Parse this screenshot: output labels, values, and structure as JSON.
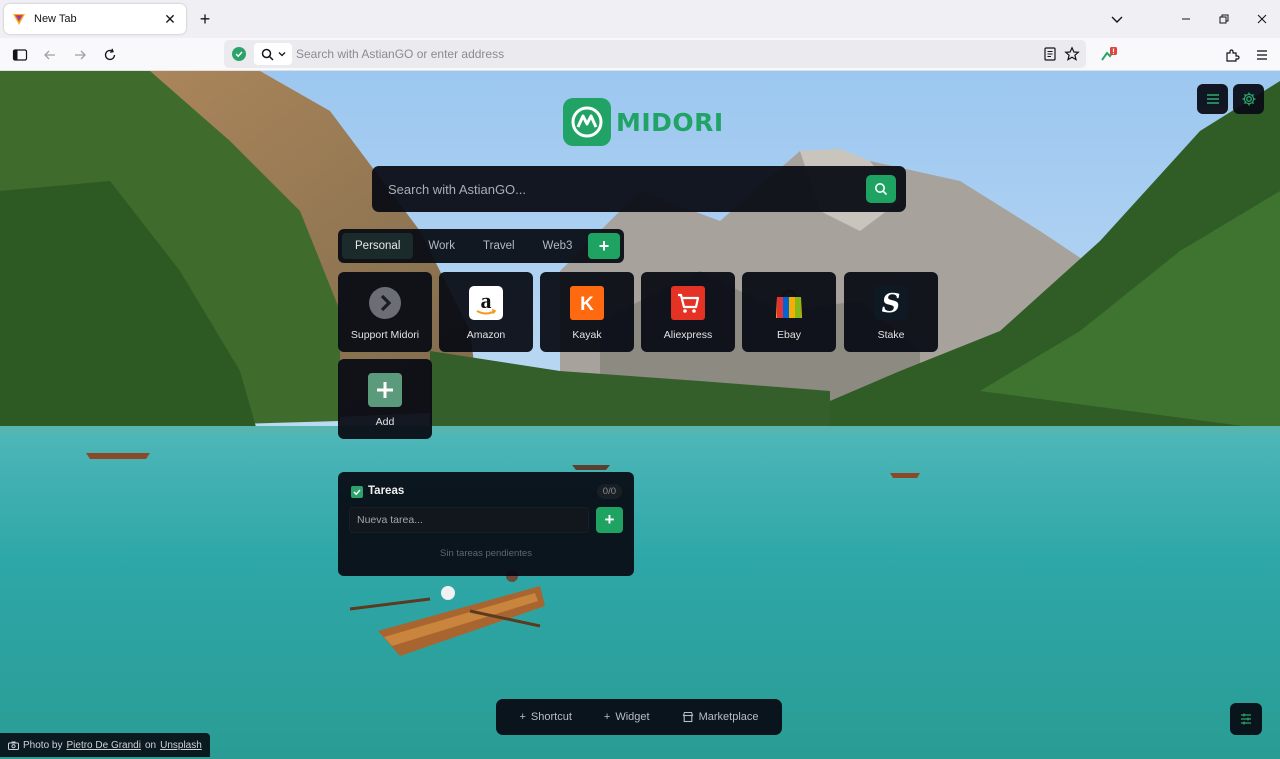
{
  "browser": {
    "tab_title": "New Tab",
    "address_placeholder": "Search with AstianGO or enter address"
  },
  "logo": {
    "text": "MIDORI"
  },
  "search": {
    "placeholder": "Search with AstianGO..."
  },
  "groups": [
    {
      "label": "Personal",
      "active": true
    },
    {
      "label": "Work"
    },
    {
      "label": "Travel"
    },
    {
      "label": "Web3"
    }
  ],
  "shortcuts": [
    {
      "label": "Support Midori",
      "icon": "chevron-right-icon"
    },
    {
      "label": "Amazon",
      "icon": "amazon-icon"
    },
    {
      "label": "Kayak",
      "icon": "kayak-icon"
    },
    {
      "label": "Aliexpress",
      "icon": "aliexpress-icon"
    },
    {
      "label": "Ebay",
      "icon": "ebay-icon"
    },
    {
      "label": "Stake",
      "icon": "stake-icon"
    },
    {
      "label": "Add",
      "icon": "plus-icon"
    }
  ],
  "tasks": {
    "title": "Tareas",
    "count": "0/0",
    "input_placeholder": "Nueva tarea...",
    "empty_text": "Sin tareas pendientes"
  },
  "dock": {
    "shortcut_label": "Shortcut",
    "widget_label": "Widget",
    "marketplace_label": "Marketplace"
  },
  "credit": {
    "prefix": "Photo by",
    "author": "Pietro De Grandi",
    "on": "on",
    "source": "Unsplash"
  },
  "colors": {
    "accent": "#1ea362",
    "panel": "#080c14"
  }
}
